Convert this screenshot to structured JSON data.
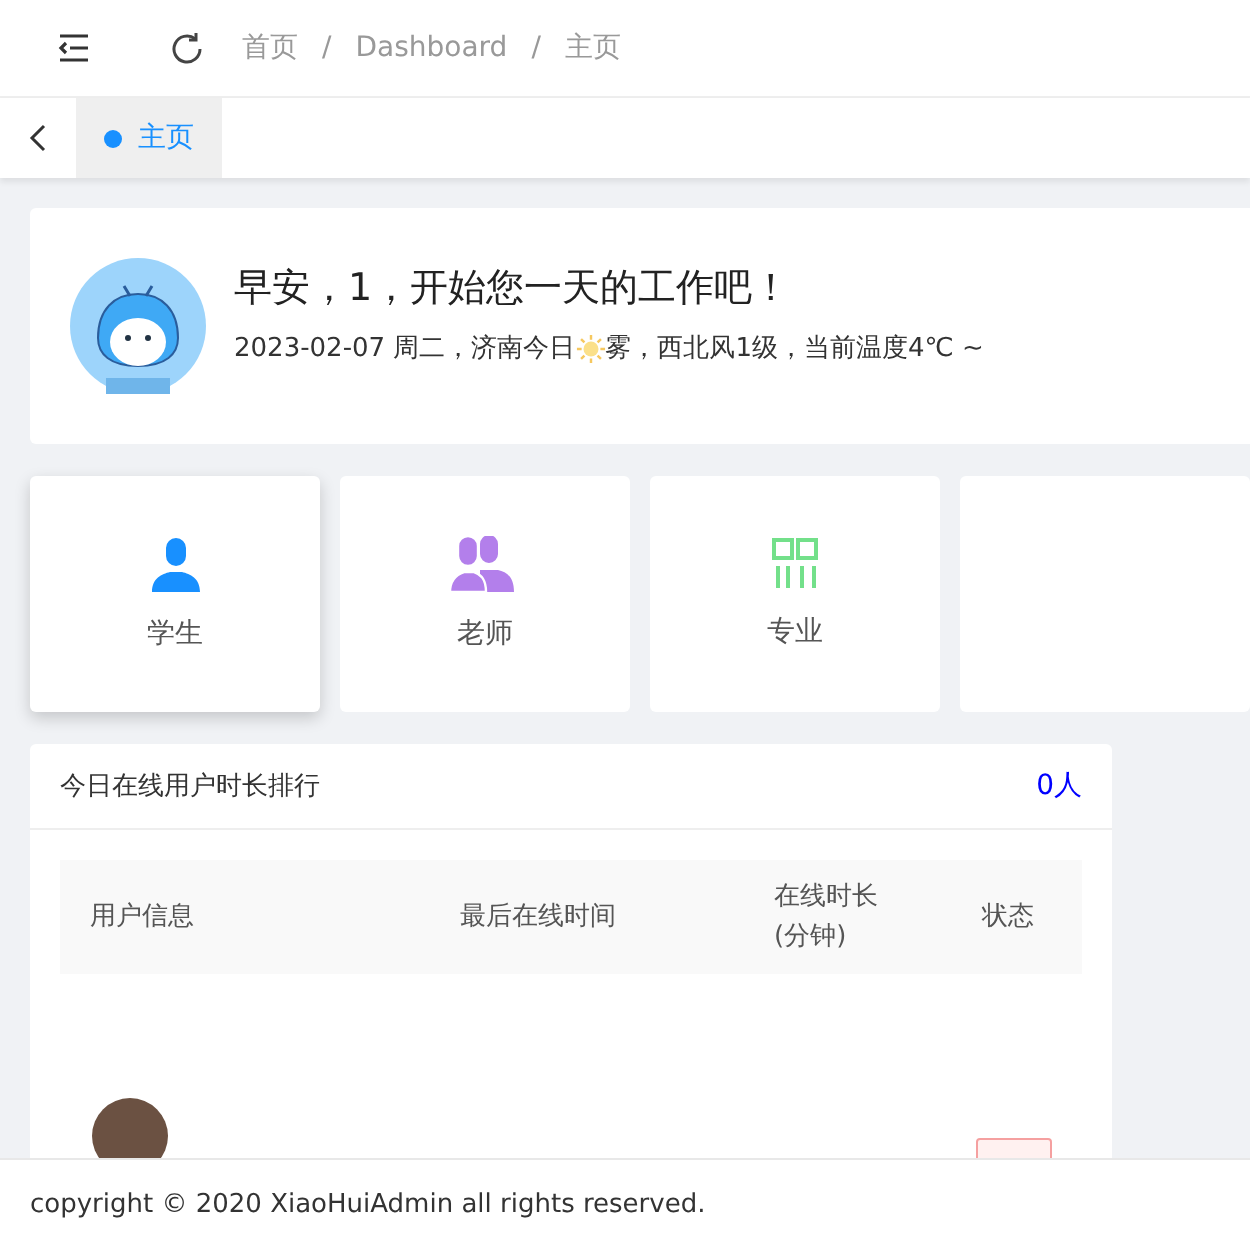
{
  "header": {
    "breadcrumb": [
      "首页",
      "Dashboard",
      "主页"
    ],
    "separator": "/"
  },
  "tabs": [
    {
      "label": "主页",
      "selected": true
    }
  ],
  "welcome": {
    "greeting": "早安，1，开始您一天的工作吧！",
    "weather_before": "2023-02-07 周二，济南今日",
    "weather_after": "雾，西北风1级，当前温度4℃ ~"
  },
  "stats": [
    {
      "kind": "student",
      "label": "学生",
      "selected": true,
      "color": "#1890ff"
    },
    {
      "kind": "teacher",
      "label": "老师",
      "selected": false,
      "color": "#b37feb"
    },
    {
      "kind": "major",
      "label": "专业",
      "selected": false,
      "color": "#73e08a"
    }
  ],
  "ranking": {
    "title": "今日在线用户时长排行",
    "count": "0人",
    "columns": [
      "用户信息",
      "最后在线时间",
      "在线时长\n(分钟)",
      "状态"
    ]
  },
  "footer": {
    "text": "copyright © 2020 XiaoHuiAdmin all rights reserved."
  }
}
